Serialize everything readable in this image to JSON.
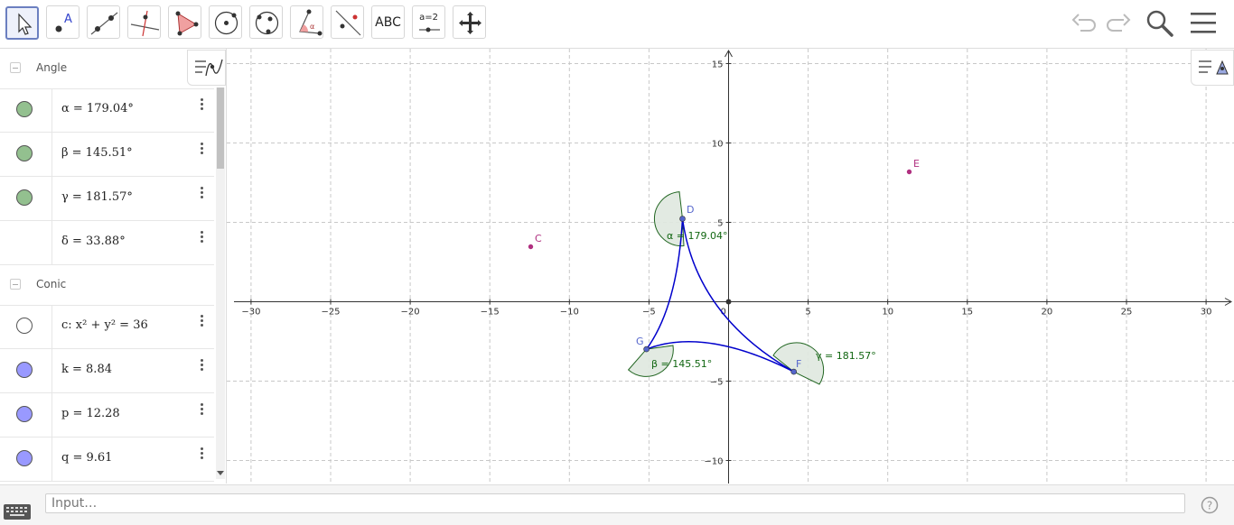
{
  "toolbar": {
    "tools": [
      {
        "name": "move-tool",
        "selected": true
      },
      {
        "name": "point-tool"
      },
      {
        "name": "line-tool"
      },
      {
        "name": "perpendicular-line-tool"
      },
      {
        "name": "polygon-tool"
      },
      {
        "name": "circle-center-point-tool"
      },
      {
        "name": "circle-three-points-tool"
      },
      {
        "name": "angle-tool"
      },
      {
        "name": "reflect-about-line-tool"
      },
      {
        "name": "text-tool",
        "label": "ABC"
      },
      {
        "name": "slider-tool",
        "label": "a=2"
      },
      {
        "name": "move-graphics-view-tool"
      }
    ]
  },
  "algebra": {
    "groups": [
      {
        "name": "Angle",
        "items": [
          {
            "text": "α = 179.04°",
            "color": "#93c08f",
            "visible": true
          },
          {
            "text": "β = 145.51°",
            "color": "#93c08f",
            "visible": true
          },
          {
            "text": "γ = 181.57°",
            "color": "#93c08f",
            "visible": true
          },
          {
            "text": "δ = 33.88°",
            "color": "",
            "visible": false
          }
        ]
      },
      {
        "name": "Conic",
        "items": [
          {
            "text": "c: x² + y² = 36",
            "color": "#ffffff",
            "visible": true
          },
          {
            "text": "k = 8.84",
            "color": "#9999ff",
            "visible": true
          },
          {
            "text": "p = 12.28",
            "color": "#9999ff",
            "visible": true
          },
          {
            "text": "q = 9.61",
            "color": "#9999ff",
            "visible": true
          }
        ]
      }
    ]
  },
  "graphics": {
    "xticks": [
      "−30",
      "−25",
      "−20",
      "−15",
      "−10",
      "−5",
      "0",
      "5",
      "10",
      "15",
      "20",
      "25",
      "30"
    ],
    "yticks": [
      "15",
      "10",
      "5",
      "−5",
      "−10"
    ],
    "points": [
      {
        "name": "C",
        "color": "#b03080"
      },
      {
        "name": "E",
        "color": "#b03080"
      },
      {
        "name": "D",
        "color": "#5566cc"
      },
      {
        "name": "G",
        "color": "#5566cc"
      },
      {
        "name": "F",
        "color": "#5566cc"
      }
    ],
    "angles": {
      "alpha": "α = 179.04°",
      "beta": "β = 145.51°",
      "gamma": "γ = 181.57°"
    },
    "colors": {
      "angle_fill": "#dfe8df",
      "angle_stroke": "#226622",
      "angle_text": "#116611",
      "arc": "#0000cc"
    }
  },
  "input": {
    "placeholder": "Input…"
  }
}
